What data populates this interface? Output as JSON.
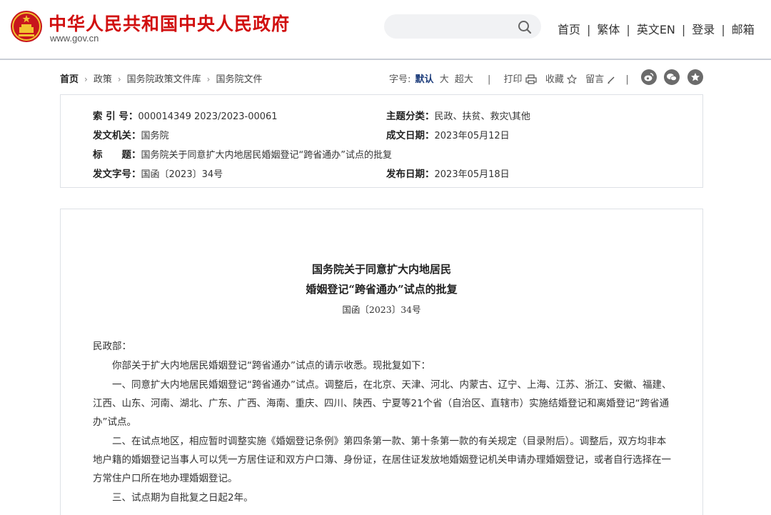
{
  "header": {
    "site_title": "中华人民共和国中央人民政府",
    "site_url": "www.gov.cn",
    "search_placeholder": "",
    "nav": [
      "首页",
      "繁体",
      "英文EN",
      "登录",
      "邮箱"
    ]
  },
  "breadcrumb": [
    "首页",
    "政策",
    "国务院政策文件库",
    "国务院文件"
  ],
  "tools": {
    "font_label": "字号:",
    "font_sizes": [
      "默认",
      "大",
      "超大"
    ],
    "print": "打印",
    "favorite": "收藏",
    "comment": "留言"
  },
  "colors": {
    "brand_red": "#d10f0f",
    "accent_blue": "#1b3b7a"
  },
  "info": {
    "index_no_label": "索 引 号：",
    "index_no": "000014349 2023/2023-00061",
    "topic_label": "主题分类：",
    "topic": "民政、扶贫、救灾\\其他",
    "issuer_label": "发文机关：",
    "issuer": "国务院",
    "written_date_label": "成文日期：",
    "written_date": "2023年05月12日",
    "title_label": "标　　题：",
    "title": "国务院关于同意扩大内地居民婚姻登记“跨省通办”试点的批复",
    "doc_no_label": "发文字号：",
    "doc_no": "国函〔2023〕34号",
    "publish_date_label": "发布日期：",
    "publish_date": "2023年05月18日"
  },
  "article": {
    "title_line1": "国务院关于同意扩大内地居民",
    "title_line2": "婚姻登记“跨省通办”试点的批复",
    "doc_no": "国函〔2023〕34号",
    "salutation": "民政部：",
    "paragraphs": [
      "你部关于扩大内地居民婚姻登记“跨省通办”试点的请示收悉。现批复如下：",
      "一、同意扩大内地居民婚姻登记“跨省通办”试点。调整后，在北京、天津、河北、内蒙古、辽宁、上海、江苏、浙江、安徽、福建、江西、山东、河南、湖北、广东、广西、海南、重庆、四川、陕西、宁夏等21个省（自治区、直辖市）实施结婚登记和离婚登记“跨省通办”试点。",
      "二、在试点地区，相应暂时调整实施《婚姻登记条例》第四条第一款、第十条第一款的有关规定（目录附后）。调整后，双方均非本地户籍的婚姻登记当事人可以凭一方居住证和双方户口簿、身份证，在居住证发放地婚姻登记机关申请办理婚姻登记，或者自行选择在一方常住户口所在地办理婚姻登记。",
      "三、试点期为自批复之日起2年。"
    ]
  }
}
